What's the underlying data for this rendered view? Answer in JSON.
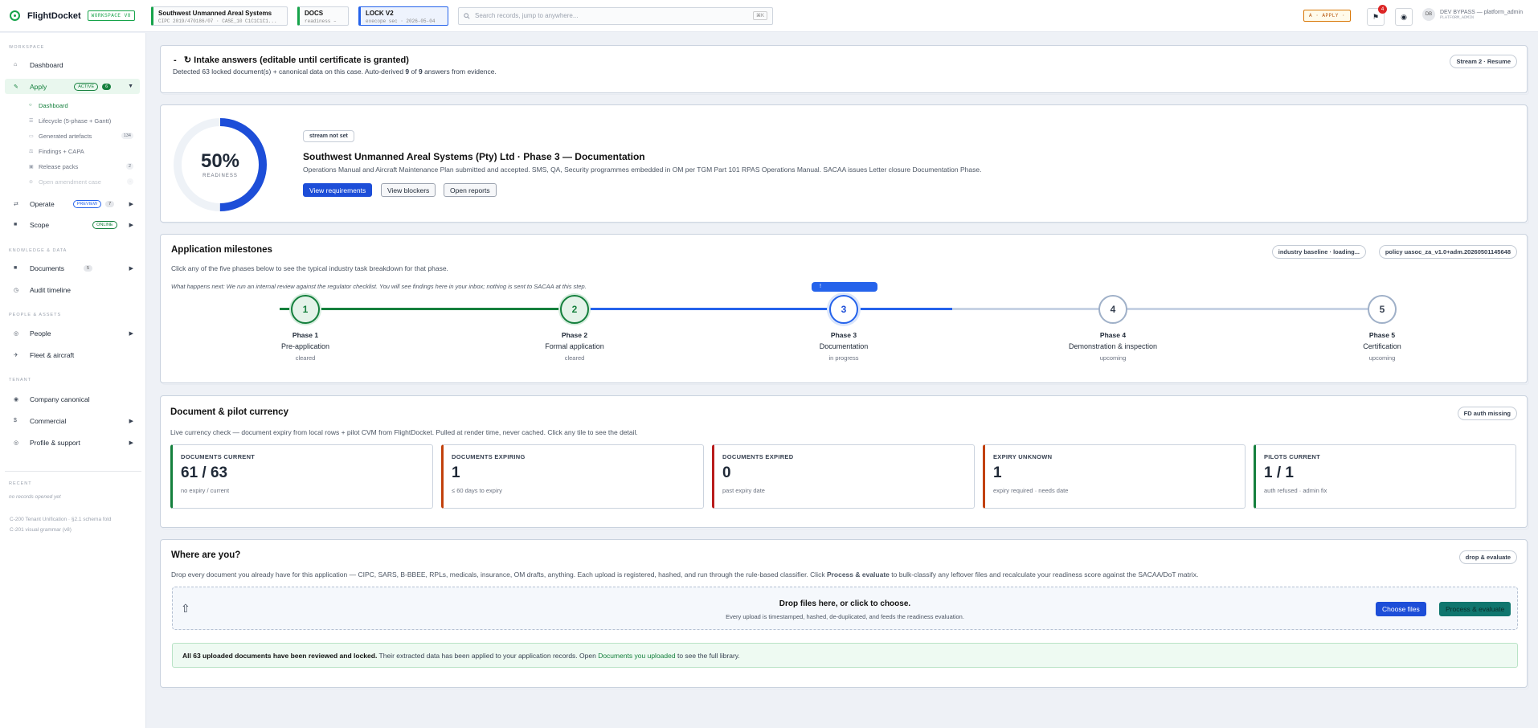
{
  "topbar": {
    "app_name": "FlightDocket",
    "workspace_badge": "WORKSPACE V8",
    "case": {
      "name": "Southwest Unmanned Areal Systems",
      "meta": "CIPC 2019/470186/07 · CASE_10 C1C1C1C1..."
    },
    "docs": {
      "label": "DOCS",
      "meta": "readiness –"
    },
    "lock": {
      "label": "LOCK V2",
      "meta": "execope sec · 2026-05-04"
    },
    "search_placeholder": "Search records, jump to anywhere...",
    "search_kbd": "⌘K",
    "mode_button": "A · APPLY ·",
    "notification_count": "4",
    "user_initials": "DB",
    "user_name": "DEV BYPASS — platform_admin",
    "user_role": "PLATFORM_ADMIN"
  },
  "sidebar": {
    "sec_workspace": "WORKSPACE",
    "dashboard": "Dashboard",
    "apply": {
      "label": "Apply",
      "tag": "ACTIVE",
      "count": "6"
    },
    "apply_subs": [
      {
        "label": "Dashboard",
        "count": ""
      },
      {
        "label": "Lifecycle (5-phase + Gantt)",
        "count": ""
      },
      {
        "label": "Generated artefacts",
        "count": "134"
      },
      {
        "label": "Findings + CAPA",
        "count": ""
      },
      {
        "label": "Release packs",
        "count": "2"
      },
      {
        "label": "Open amendment case",
        "count": ""
      }
    ],
    "operate": {
      "label": "Operate",
      "tag": "PREVIEW",
      "count": "7"
    },
    "scope": {
      "label": "Scope",
      "tag": "ONLINE"
    },
    "sec_knowledge": "KNOWLEDGE & DATA",
    "documents": {
      "label": "Documents",
      "count": "5"
    },
    "audit": "Audit timeline",
    "sec_people": "PEOPLE & ASSETS",
    "people": "People",
    "fleet": "Fleet & aircraft",
    "sec_tenant": "TENANT",
    "company": "Company canonical",
    "commercial": "Commercial",
    "profile": "Profile & support",
    "sec_recent": "RECENT",
    "recent_empty": "no records opened yet",
    "ver1": "C-200 Tenant Unification · §2.1 schema fold",
    "ver2": "C-201 visual grammar (v8)"
  },
  "intake": {
    "title": "Intake answers (editable until certificate is granted)",
    "toggle": "-",
    "desc_pre": "Detected 63 locked document(s) + canonical data on this case. Auto-derived ",
    "derived": "9",
    "desc_mid": " of ",
    "total": "9",
    "desc_post": " answers from evidence.",
    "pill": "Stream 2 · Resume"
  },
  "readiness": {
    "percent": 50,
    "value": "50%",
    "label": "READINESS",
    "stream": "stream not set",
    "title": "Southwest Unmanned Areal Systems (Pty) Ltd · Phase 3 — Documentation",
    "desc": "Operations Manual and Aircraft Maintenance Plan submitted and accepted. SMS, QA, Security programmes embedded in OM per TGM Part 101 RPAS Operations Manual. SACAA issues Letter closure Documentation Phase.",
    "btn_requirements": "View requirements",
    "btn_blockers": "View blockers",
    "btn_reports": "Open reports"
  },
  "milestones": {
    "title": "Application milestones",
    "desc": "Click any of the five phases below to see the typical industry task breakdown for that phase.",
    "next": "What happens next: We run an internal review against the regulator checklist. You will see findings here in your inbox; nothing is sent to SACAA at this step.",
    "pill_baseline": "industry baseline · loading...",
    "pill_policy": "policy uasoc_za_v1.0+adm.20260501145648",
    "tooltip": "!",
    "phases": [
      {
        "num": "1",
        "phase": "Phase 1",
        "name": "Pre-application",
        "status": "cleared",
        "state": "done"
      },
      {
        "num": "2",
        "phase": "Phase 2",
        "name": "Formal application",
        "status": "cleared",
        "state": "done"
      },
      {
        "num": "3",
        "phase": "Phase 3",
        "name": "Documentation",
        "status": "in progress",
        "state": "current"
      },
      {
        "num": "4",
        "phase": "Phase 4",
        "name": "Demonstration & inspection",
        "status": "upcoming",
        "state": "upcoming"
      },
      {
        "num": "5",
        "phase": "Phase 5",
        "name": "Certification",
        "status": "upcoming",
        "state": "upcoming"
      }
    ]
  },
  "currency": {
    "title": "Document & pilot currency",
    "desc": "Live currency check — document expiry from local rows + pilot CVM from FlightDocket. Pulled at render time, never cached. Click any tile to see the detail.",
    "pill": "FD auth missing",
    "tiles": [
      {
        "label": "DOCUMENTS CURRENT",
        "value": "61 / 63",
        "sub": "no expiry / current",
        "color": "#15803d"
      },
      {
        "label": "DOCUMENTS EXPIRING",
        "value": "1",
        "sub": "≤ 60 days to expiry",
        "color": "#c2410c"
      },
      {
        "label": "DOCUMENTS EXPIRED",
        "value": "0",
        "sub": "past expiry date",
        "color": "#b91c1c"
      },
      {
        "label": "EXPIRY UNKNOWN",
        "value": "1",
        "sub": "expiry required · needs date",
        "color": "#c2410c"
      },
      {
        "label": "PILOTS CURRENT",
        "value": "1 / 1",
        "sub": "auth refused · admin fix",
        "color": "#15803d"
      }
    ]
  },
  "where": {
    "title": "Where are you?",
    "desc_pre": "Drop every document you already have for this application — CIPC, SARS, B-BBEE, RPLs, medicals, insurance, OM drafts, anything. Each upload is registered, hashed, and run through the rule-based classifier. Click ",
    "desc_bold": "Process & evaluate",
    "desc_post": " to bulk-classify any leftover files and recalculate your readiness score against the SACAA/DoT matrix.",
    "pill": "drop & evaluate",
    "drop_title": "Drop files here, or click to choose.",
    "drop_sub": "Every upload is timestamped, hashed, de-duplicated, and feeds the readiness evaluation.",
    "btn_choose": "Choose files",
    "btn_process": "Process & evaluate",
    "locked_bold": "All 63 uploaded documents have been reviewed and locked.",
    "locked_mid": " Their extracted data has been applied to your application records. Open ",
    "locked_link": "Documents you uploaded",
    "locked_post": " to see the full library."
  }
}
